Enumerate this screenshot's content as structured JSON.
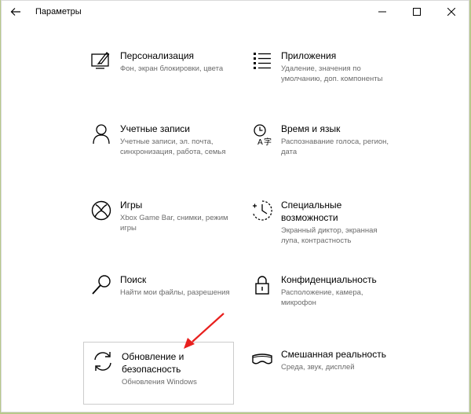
{
  "window": {
    "title": "Параметры"
  },
  "tiles": [
    {
      "title": "Персонализация",
      "description": "Фон, экран блокировки, цвета",
      "icon": "personalization-icon"
    },
    {
      "title": "Приложения",
      "description": "Удаление, значения по умолчанию, доп. компоненты",
      "icon": "apps-icon"
    },
    {
      "title": "Учетные записи",
      "description": "Учетные записи, эл. почта, синхронизация, работа, семья",
      "icon": "person-icon"
    },
    {
      "title": "Время и язык",
      "description": "Распознавание голоса, регион, дата",
      "icon": "time-language-icon"
    },
    {
      "title": "Игры",
      "description": "Xbox Game Bar, снимки, режим игры",
      "icon": "xbox-icon"
    },
    {
      "title": "Специальные возможности",
      "description": "Экранный диктор, экранная лупа, контрастность",
      "icon": "ease-of-access-icon"
    },
    {
      "title": "Поиск",
      "description": "Найти мои файлы, разрешения",
      "icon": "search-icon"
    },
    {
      "title": "Конфиденциальность",
      "description": "Расположение, камера, микрофон",
      "icon": "lock-icon"
    },
    {
      "title": "Обновление и безопасность",
      "description": "Обновления Windows",
      "icon": "update-icon"
    },
    {
      "title": "Смешанная реальность",
      "description": "Среда, звук, дисплей",
      "icon": "mixed-reality-icon"
    }
  ],
  "annotation": {
    "arrow_color": "#e8201e"
  }
}
